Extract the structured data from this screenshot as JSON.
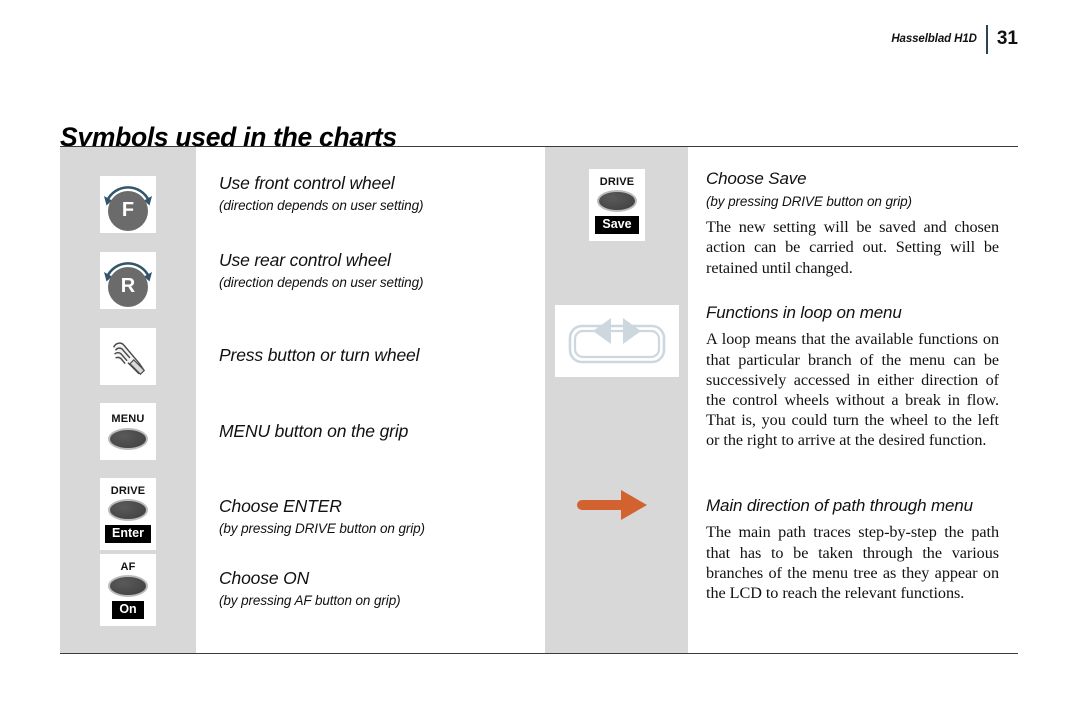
{
  "header": {
    "brand": "Hasselblad H1D",
    "page_number": "31"
  },
  "section": {
    "title": "Symbols used in the charts"
  },
  "colors": {
    "panel_gray": "#d8d8d8",
    "wheel_gray": "#6b6b6b",
    "arc_blue": "#33556b",
    "loop_blue": "#ccd8de",
    "arrow_orange": "#d2622f",
    "rule_dark": "#3a3a3a",
    "header_rule": "#2c4452"
  },
  "left_column": {
    "rows": [
      {
        "icon": "front-control-wheel-icon",
        "icon_letter": "F",
        "lead": "Use front control wheel",
        "sub": "(direction depends on user setting)"
      },
      {
        "icon": "rear-control-wheel-icon",
        "icon_letter": "R",
        "lead": "Use rear control wheel",
        "sub": "(direction depends on user setting)"
      },
      {
        "icon": "pointing-hand-icon",
        "lead": "Press button or turn wheel",
        "sub": ""
      },
      {
        "icon": "menu-button-icon",
        "icon_label": "MENU",
        "lead": "MENU button on the grip",
        "sub": ""
      },
      {
        "icon": "drive-button-enter-icon",
        "icon_label": "DRIVE",
        "icon_tag": "Enter",
        "lead": "Choose ENTER",
        "sub": "(by pressing DRIVE button on grip)"
      },
      {
        "icon": "af-button-on-icon",
        "icon_label": "AF",
        "icon_tag": "On",
        "lead": "Choose ON",
        "sub": "(by pressing AF button on grip)"
      }
    ]
  },
  "right_column": {
    "rows": [
      {
        "icon": "drive-button-save-icon",
        "icon_label": "DRIVE",
        "icon_tag": "Save",
        "lead": "Choose Save",
        "sub": "(by pressing DRIVE button on grip)",
        "body": "The new setting will be saved and chosen action can be carried out. Setting will be retained until changed."
      },
      {
        "icon": "menu-loop-icon",
        "lead": "Functions in loop on menu",
        "sub": "",
        "body": "A loop means that the available functions on that particular branch of the menu can be successively accessed in either direction of the control wheels without a break in flow. That is, you could turn the wheel to the left or the right to arrive at the desired function."
      },
      {
        "icon": "main-path-arrow-icon",
        "lead": "Main direction of path through menu",
        "sub": "",
        "body": "The main path traces step-by-step the path that has to be taken through the various branches of the menu tree as they appear on the LCD to reach the relevant functions."
      }
    ]
  }
}
